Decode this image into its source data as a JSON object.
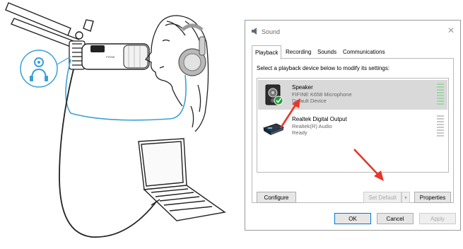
{
  "dialog": {
    "title": "Sound",
    "tabs": [
      "Playback",
      "Recording",
      "Sounds",
      "Communications"
    ],
    "active_tab": "Playback",
    "instruction": "Select a playback device below to modify its settings:",
    "devices": [
      {
        "name": "Speaker",
        "line1": "FIFINE K658 Microphone",
        "line2": "Default Device",
        "selected": true,
        "icon": "speaker-icon"
      },
      {
        "name": "Realtek Digital Output",
        "line1": "Realtek(R) Audio",
        "line2": "Ready",
        "selected": false,
        "icon": "digital-output-icon"
      }
    ],
    "buttons": {
      "configure": "Configure",
      "set_default": "Set Default",
      "properties": "Properties",
      "ok": "OK",
      "cancel": "Cancel",
      "apply": "Apply"
    }
  },
  "illustration": {
    "mic_brand": "FIFINE"
  },
  "colors": {
    "cable": "#3aa0d8",
    "accent_arrow": "#e8362a",
    "check": "#1e9e3a",
    "selected_row": "#d9d9d9",
    "meter": "#9fd8a5"
  }
}
